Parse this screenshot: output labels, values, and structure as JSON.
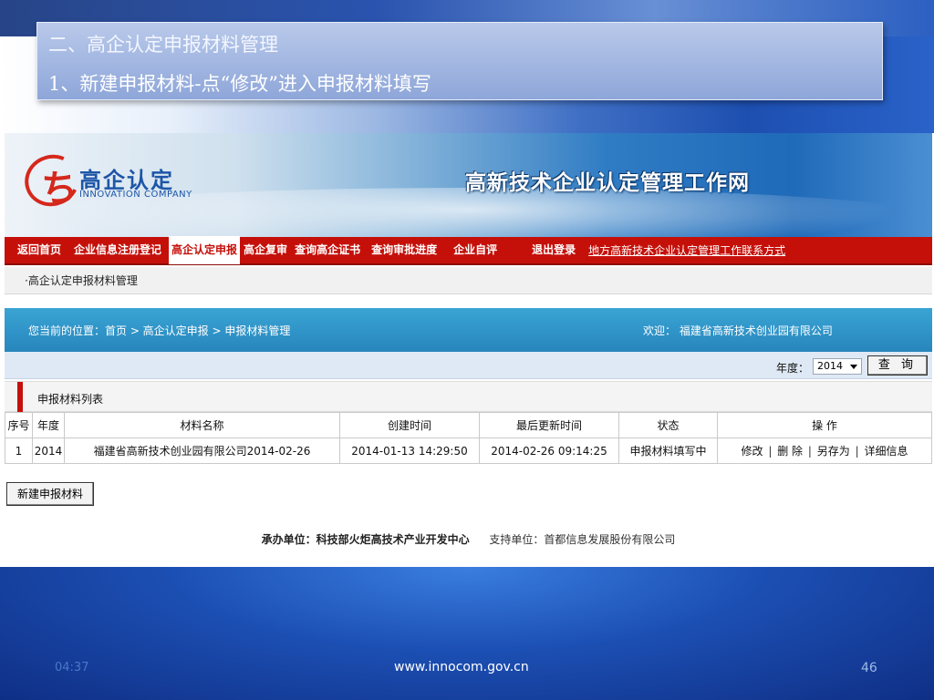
{
  "slide": {
    "title_line1": "二、高企认定申报材料管理",
    "title_line2": "1、新建申报材料-点“修改”进入申报材料填写",
    "date": "04:37",
    "url": "www.innocom.gov.cn",
    "page": "46"
  },
  "site": {
    "logo_cn": "高企认定",
    "logo_en": "INNOVATION COMPANY",
    "site_title": "高新技术企业认定管理工作网",
    "nav": {
      "items": [
        "返回首页",
        "企业信息注册登记",
        "高企认定申报",
        "高企复审",
        "查询高企证书",
        "查询审批进度",
        "企业自评",
        "退出登录"
      ],
      "active": "高企认定申报",
      "contact_link": "地方高新技术企业认定管理工作联系方式"
    },
    "subnav": "·高企认定申报材料管理",
    "breadcrumb": "您当前的位置：首页 > 高企认定申报 > 申报材料管理",
    "welcome": "欢迎：  福建省高新技术创业园有限公司",
    "year_label": "年度：",
    "year_value": "2014",
    "query_button": "查 询",
    "list_title": "申报材料列表",
    "table": {
      "headers": [
        "序号",
        "年度",
        "材料名称",
        "创建时间",
        "最后更新时间",
        "状态",
        "操 作"
      ],
      "rows": [
        {
          "index": "1",
          "year": "2014",
          "name": "福建省高新技术创业园有限公司2014-02-26",
          "created": "2014-01-13 14:29:50",
          "updated": "2014-02-26 09:14:25",
          "status": "申报材料填写中",
          "actions": {
            "edit": "修改",
            "delete": "删 除",
            "saveas": "另存为",
            "detail": "详细信息",
            "separator": "|"
          }
        }
      ]
    },
    "new_button": "新建申报材料",
    "footer_host": "承办单位：科技部火炬高技术产业开发中心",
    "footer_support": "支持单位：首都信息发展股份有限公司"
  }
}
